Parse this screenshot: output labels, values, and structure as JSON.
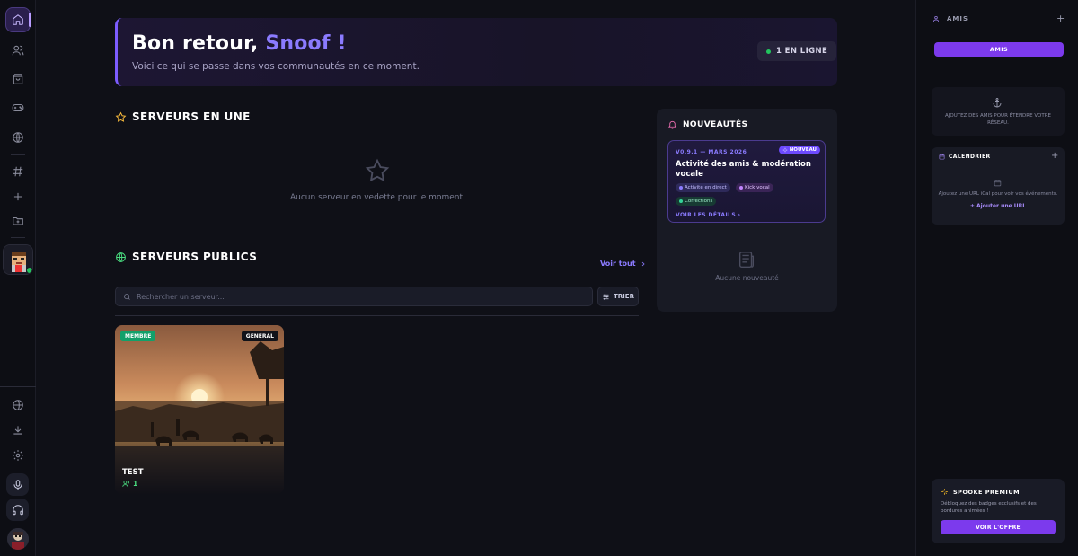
{
  "welcome": {
    "title_prefix": "Bon retour,",
    "username": "Snoof !",
    "subtitle": "Voici ce qui se passe dans vos communautés en ce moment.",
    "online": "1 EN LIGNE"
  },
  "featured": {
    "title": "SERVEURS EN UNE",
    "empty": "Aucun serveur en vedette pour le moment"
  },
  "public_servers": {
    "title": "SERVEURS PUBLICS",
    "see_all": "Voir tout",
    "search_placeholder": "Rechercher un serveur...",
    "sort_label": "TRIER",
    "servers": [
      {
        "name": "TEST",
        "badge": "MEMBRE",
        "category": "GENERAL",
        "members": "1"
      }
    ]
  },
  "news": {
    "title": "NOUVEAUTÉS",
    "card": {
      "version": "V0.9.1 — MARS 2026",
      "badge": "NOUVEAU",
      "title": "Activité des amis & modération vocale",
      "tags": [
        "Activité en direct",
        "Kick vocal",
        "Corrections"
      ],
      "details": "VOIR LES DÉTAILS"
    },
    "empty": "Aucune nouveauté"
  },
  "friends": {
    "title": "AMIS",
    "button": "AMIS",
    "empty": "AJOUTEZ DES AMIS POUR ÉTENDRE VOTRE RÉSEAU."
  },
  "calendar": {
    "title": "CALENDRIER",
    "text": "Ajoutez une URL iCal pour voir vos événements.",
    "add": "+ Ajouter une URL"
  },
  "premium": {
    "title": "SPOOKE PREMIUM",
    "text": "Débloquez des badges exclusifs et des bordures animées !",
    "button": "VOIR L'OFFRE"
  },
  "colors": {
    "accent": "#7c3aed",
    "accent_text": "#8b7bff",
    "online": "#22c55e",
    "member_badge": "#12a06a"
  }
}
